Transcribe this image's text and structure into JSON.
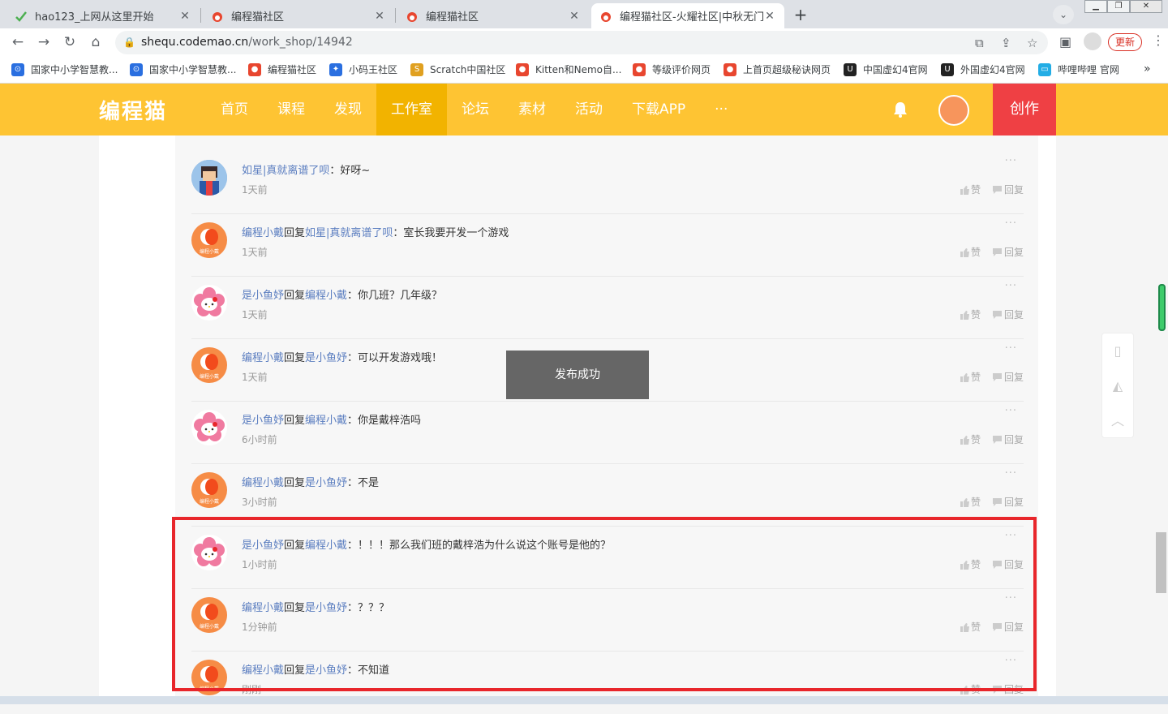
{
  "tabs": [
    {
      "title": "hao123_上网从这里开始",
      "close": "✕"
    },
    {
      "title": "编程猫社区",
      "close": "✕"
    },
    {
      "title": "编程猫社区",
      "close": "✕"
    },
    {
      "title": "编程猫社区-火耀社区|中秋无门槛",
      "close": "✕"
    }
  ],
  "toolbar": {
    "url_host": "shequ.codemao.cn",
    "url_path": "/work_shop/14942",
    "update_label": "更新"
  },
  "bookmarks": [
    {
      "label": "国家中小学智慧教...",
      "color": "#2a6fe0"
    },
    {
      "label": "国家中小学智慧教...",
      "color": "#2a6fe0"
    },
    {
      "label": "编程猫社区",
      "color": "#e8462f"
    },
    {
      "label": "小码王社区",
      "color": "#2a6fe0"
    },
    {
      "label": "Scratch中国社区",
      "color": "#e0a020"
    },
    {
      "label": "Kitten和Nemo自...",
      "color": "#e8462f"
    },
    {
      "label": "等级评价网页",
      "color": "#e8462f"
    },
    {
      "label": "上首页超级秘诀网页",
      "color": "#e8462f"
    },
    {
      "label": "中国虚幻4官网",
      "color": "#222222"
    },
    {
      "label": "外国虚幻4官网",
      "color": "#222222"
    },
    {
      "label": "哔哩哔哩 官网",
      "color": "#23ade5"
    }
  ],
  "site": {
    "logo": "编程猫",
    "nav": [
      "首页",
      "课程",
      "发现",
      "工作室",
      "论坛",
      "素材",
      "活动",
      "下载APP",
      "···"
    ],
    "active_nav": "工作室",
    "create_label": "创作",
    "avatar_caption": "编程小戴"
  },
  "comments": [
    {
      "user": "如星|真就离谱了呗",
      "reply": "",
      "reply_to": "",
      "text": "：好呀~",
      "time": "1天前",
      "avatar": "pixel"
    },
    {
      "user": "编程小戴",
      "reply": "回复",
      "reply_to": "如星|真就离谱了呗",
      "text": "：室长我要开发一个游戏",
      "time": "1天前",
      "avatar": "orange"
    },
    {
      "user": "是小鱼妤",
      "reply": "回复",
      "reply_to": "编程小戴",
      "text": "：你几班？几年级？",
      "time": "1天前",
      "avatar": "kitty"
    },
    {
      "user": "编程小戴",
      "reply": "回复",
      "reply_to": "是小鱼妤",
      "text": "：可以开发游戏哦！",
      "time": "1天前",
      "avatar": "orange"
    },
    {
      "user": "是小鱼妤",
      "reply": "回复",
      "reply_to": "编程小戴",
      "text": "：你是戴梓浩吗",
      "time": "6小时前",
      "avatar": "kitty"
    },
    {
      "user": "编程小戴",
      "reply": "回复",
      "reply_to": "是小鱼妤",
      "text": "：不是",
      "time": "3小时前",
      "avatar": "orange"
    },
    {
      "user": "是小鱼妤",
      "reply": "回复",
      "reply_to": "编程小戴",
      "text": "：！！！那么我们班的戴梓浩为什么说这个账号是他的？",
      "time": "1小时前",
      "avatar": "kitty"
    },
    {
      "user": "编程小戴",
      "reply": "回复",
      "reply_to": "是小鱼妤",
      "text": "：？？？",
      "time": "1分钟前",
      "avatar": "orange"
    },
    {
      "user": "编程小戴",
      "reply": "回复",
      "reply_to": "是小鱼妤",
      "text": "：不知道",
      "time": "刚刚",
      "avatar": "orange"
    }
  ],
  "comment_actions": {
    "like": "赞",
    "reply": "回复",
    "more": "···"
  },
  "toast": "发布成功"
}
